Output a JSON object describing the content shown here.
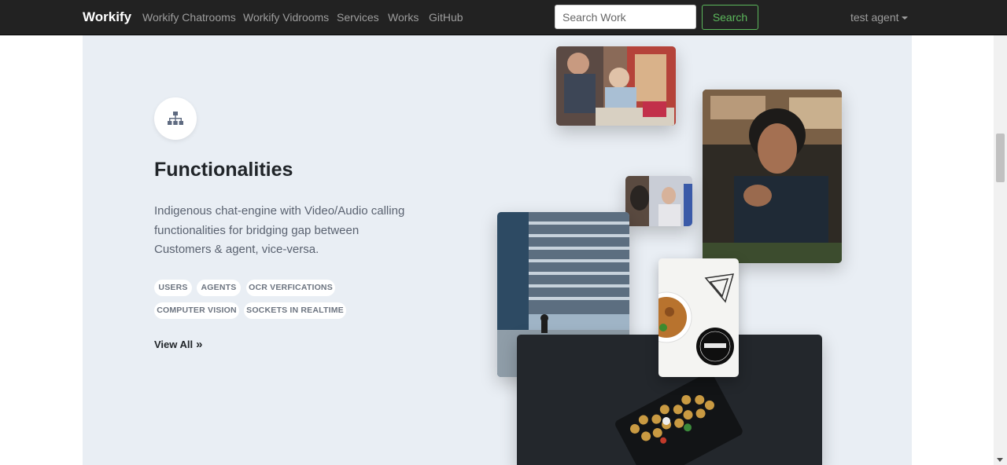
{
  "navbar": {
    "brand": "Workify",
    "links": [
      "Workify Chatrooms",
      "Workify Vidrooms",
      "Services",
      "Works",
      "GitHub"
    ],
    "search_placeholder": "Search Work",
    "search_button": "Search",
    "user": "test agent"
  },
  "feature": {
    "icon": "sitemap-icon",
    "title": "Functionalities",
    "description": "Indigenous chat-engine with Video/Audio calling functionalities for bridging gap between Customers & agent, vice-versa.",
    "tags": [
      "USERS",
      "AGENTS",
      "OCR VERFICATIONS",
      "COMPUTER VISION",
      "SOCKETS IN REALTIME"
    ],
    "view_all": "View All"
  },
  "colors": {
    "navbar_bg": "#222222",
    "section_bg": "#e9eef4",
    "search_accent": "#5cb85c"
  }
}
